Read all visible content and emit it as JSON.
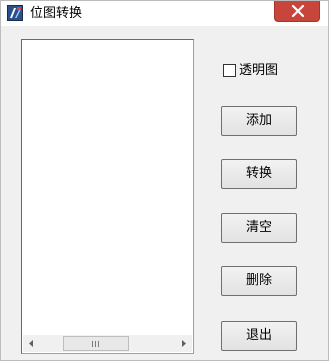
{
  "window": {
    "title": "位图转换",
    "icon": "app-icon",
    "close_icon": "close-icon"
  },
  "listbox": {
    "items": [],
    "scrollbar": {
      "left_arrow": "arrow-left-icon",
      "right_arrow": "arrow-right-icon"
    }
  },
  "options": {
    "transparent_label": "透明图",
    "transparent_checked": false
  },
  "buttons": {
    "add": "添加",
    "convert": "转换",
    "clear": "清空",
    "delete": "删除",
    "exit": "退出"
  },
  "colors": {
    "close_button": "#c7453a",
    "dialog_background": "#f0f0f0"
  }
}
